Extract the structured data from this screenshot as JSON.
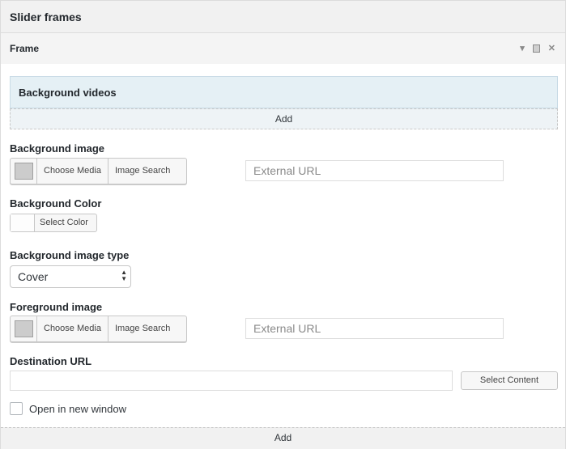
{
  "panel": {
    "title": "Slider frames"
  },
  "frame": {
    "title": "Frame",
    "collapse_symbol": "▾",
    "close_symbol": "✕"
  },
  "background_videos": {
    "title": "Background videos",
    "add_label": "Add"
  },
  "background_image": {
    "label": "Background image",
    "choose_media": "Choose Media",
    "image_search": "Image Search",
    "external_url_placeholder": "External URL"
  },
  "background_color": {
    "label": "Background Color",
    "select_color": "Select Color"
  },
  "background_image_type": {
    "label": "Background image type",
    "selected": "Cover"
  },
  "foreground_image": {
    "label": "Foreground image",
    "choose_media": "Choose Media",
    "image_search": "Image Search",
    "external_url_placeholder": "External URL"
  },
  "destination_url": {
    "label": "Destination URL",
    "value": "",
    "select_content": "Select Content"
  },
  "open_new_window": {
    "label": "Open in new window",
    "checked": false
  },
  "footer": {
    "add_label": "Add"
  }
}
